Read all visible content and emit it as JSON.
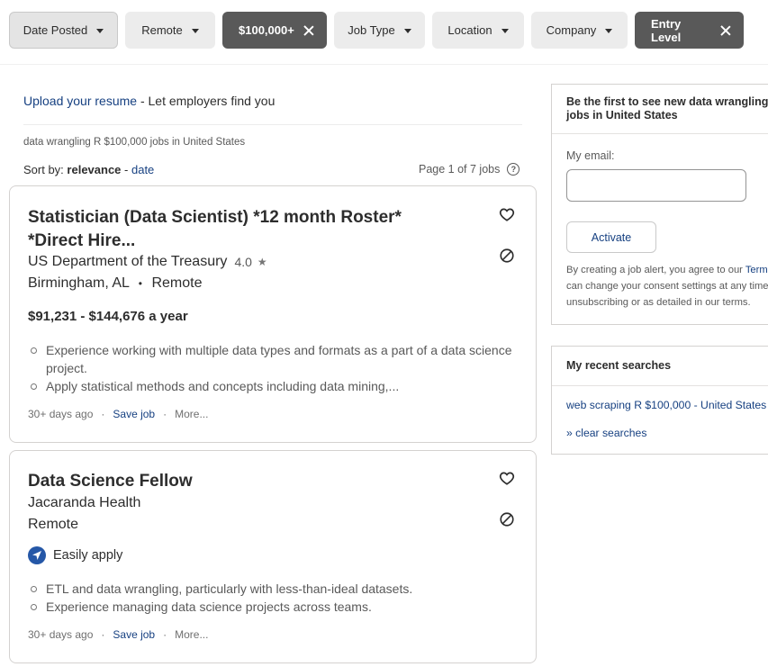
{
  "filters": [
    {
      "label": "Date Posted",
      "type": "dropdown",
      "state": "focused"
    },
    {
      "label": "Remote",
      "type": "dropdown"
    },
    {
      "label": "$100,000+",
      "type": "applied"
    },
    {
      "label": "Job Type",
      "type": "dropdown"
    },
    {
      "label": "Location",
      "type": "dropdown"
    },
    {
      "label": "Company",
      "type": "dropdown"
    },
    {
      "label": "Entry Level",
      "type": "applied"
    }
  ],
  "upload": {
    "link_text": "Upload your resume",
    "rest_text": " - Let employers find you"
  },
  "query_text": "data wrangling R $100,000 jobs in United States",
  "sort": {
    "prefix": "Sort by: ",
    "current": "relevance",
    "sep": " - ",
    "alt": "date"
  },
  "page_info": "Page 1 of 7 jobs",
  "jobs": [
    {
      "title": "Statistician (Data Scientist) *12 month Roster* *Direct Hire...",
      "company": "US Department of the Treasury",
      "rating": "4.0",
      "location": "Birmingham, AL",
      "location_sep": "•",
      "remote": "Remote",
      "salary": "$91,231 - $144,676 a year",
      "snippets": [
        "Experience working with multiple data types and formats as a part of a data science project.",
        "Apply statistical methods and concepts including data mining,..."
      ],
      "posted": "30+ days ago",
      "save": "Save job",
      "more": "More..."
    },
    {
      "title": "Data Science Fellow",
      "company": "Jacaranda Health",
      "location": "Remote",
      "easy_apply": "Easily apply",
      "snippets": [
        "ETL and data wrangling, particularly with less-than-ideal datasets.",
        "Experience managing data science projects across teams."
      ],
      "posted": "30+ days ago",
      "save": "Save job",
      "more": "More..."
    }
  ],
  "meta_sep": "·",
  "alert": {
    "heading": "Be the first to see new data wrangling R jobs in United States",
    "email_label": "My email:",
    "email_value": "",
    "activate": "Activate",
    "terms_1_pre": "By creating a job alert, you agree to our ",
    "terms_1_link": "Terms",
    "terms_2": "can change your consent settings at any time",
    "terms_3": "unsubscribing or as detailed in our terms."
  },
  "recent": {
    "heading": "My recent searches",
    "item": "web scraping R $100,000 - United States",
    "clear": "» clear searches"
  },
  "colors": {
    "link": "#164081",
    "applied_pill": "#595959",
    "easy_apply_badge": "#2557a7"
  }
}
